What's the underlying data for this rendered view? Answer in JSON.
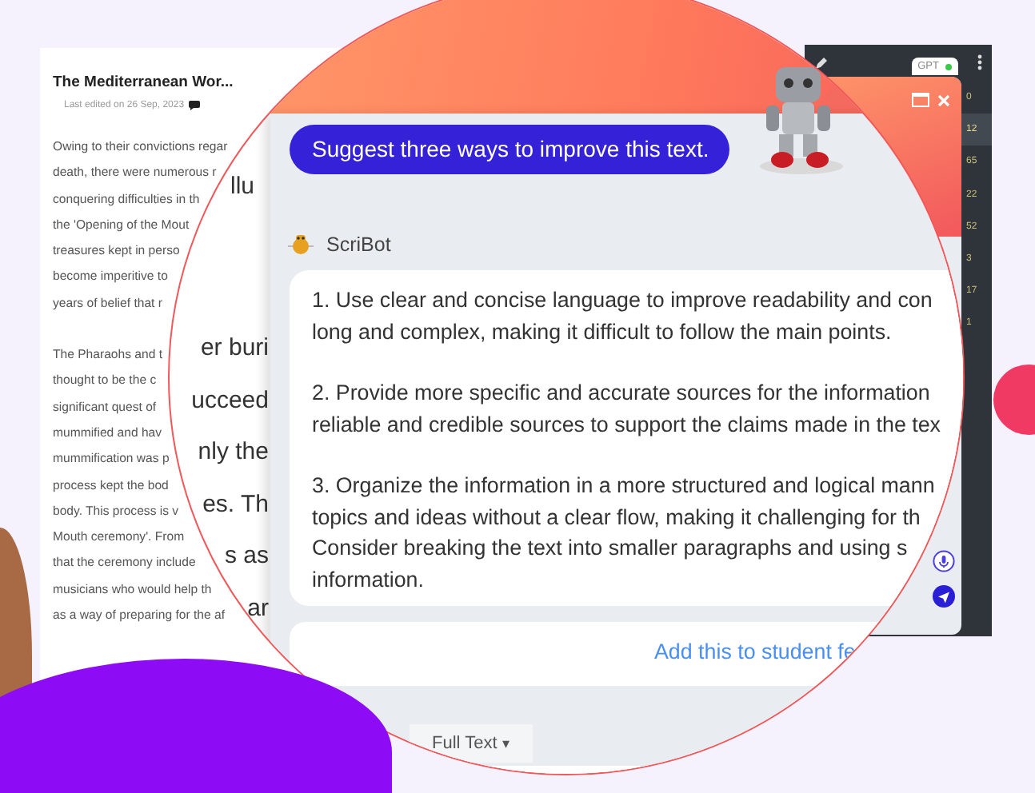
{
  "document": {
    "title": "The Mediterranean Wor...",
    "edited": "Last edited on 26 Sep, 2023",
    "paragraphs": [
      [
        "Owing to their convictions regar",
        "death, there were numerous r",
        "conquering difficulties in th",
        "the 'Opening of the Mout",
        "treasures kept in perso",
        "become imperitive to",
        "years of belief that r"
      ],
      [
        "The Pharaohs and t",
        "thought to be the c",
        "significant quest of",
        "mummified and hav",
        "mummification was p",
        "process kept the bod",
        "body. This process is v",
        "Mouth ceremony'. From",
        "that the ceremony include",
        "musicians who would help th",
        "as a way of preparing for the af"
      ]
    ]
  },
  "magnified_fragment": "llu",
  "magnified_lines": [
    "er buri",
    "ucceed",
    "nly the",
    "es. Th",
    "s as",
    "ar"
  ],
  "chat": {
    "prompt": "Suggest three ways to improve this text.",
    "bot_name": "ScriBot",
    "response": [
      [
        "1. Use clear and concise language to improve readability and con",
        "long and complex, making it difficult to follow the main points."
      ],
      [
        "2. Provide more specific and accurate sources for the information",
        "reliable and credible sources to support the claims made in the tex"
      ],
      [
        "3. Organize the information in a more structured and logical mann",
        "topics and ideas without a clear flow, making it challenging for th",
        "Consider breaking the text into smaller paragraphs and using s",
        "information."
      ]
    ],
    "action_link": "Add this to student fe",
    "view_dropdown": "Full Text",
    "view_caret": "▾"
  },
  "side_panel": {
    "badge": "GPT",
    "badge_online": true,
    "counts": [
      {
        "value": "0",
        "selected": false
      },
      {
        "value": "12",
        "selected": true
      },
      {
        "value": "65",
        "selected": false
      },
      {
        "value": "22",
        "selected": false
      },
      {
        "value": "52",
        "selected": false
      },
      {
        "value": "3",
        "selected": false
      },
      {
        "value": "17",
        "selected": false
      },
      {
        "value": "1",
        "selected": false
      }
    ]
  }
}
